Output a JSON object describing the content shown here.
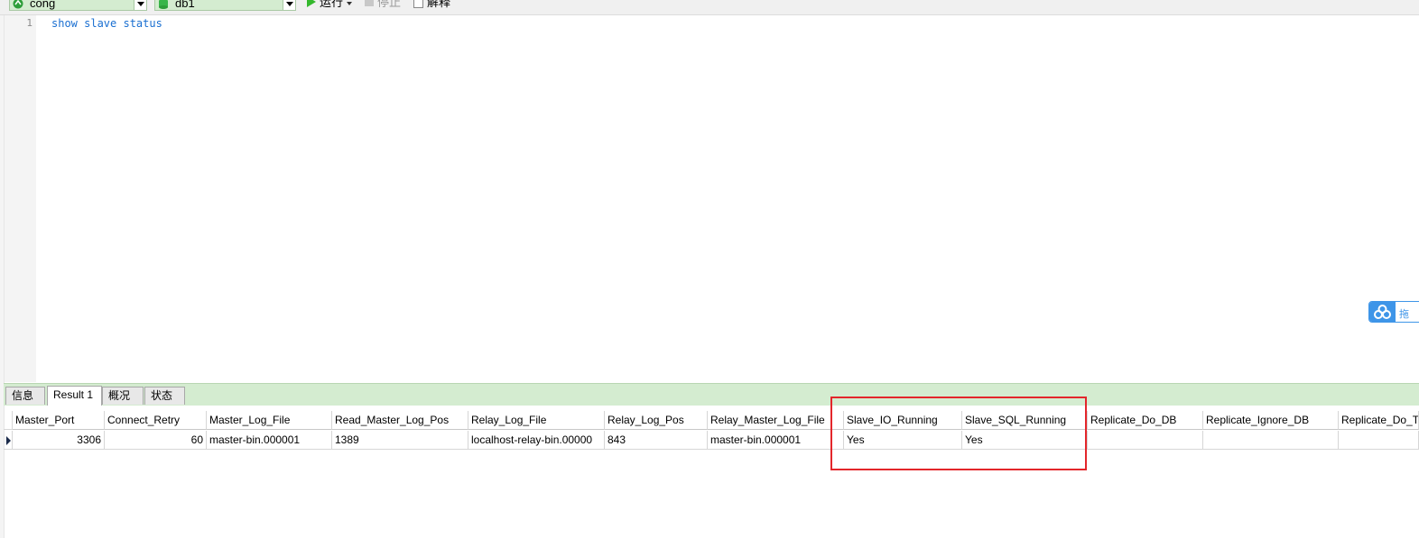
{
  "toolbar": {
    "connection": "cong",
    "database": "db1",
    "run_label": "运行",
    "stop_label": "停止",
    "explain_label": "解释"
  },
  "editor": {
    "line_number": "1",
    "code": "show slave status"
  },
  "side_widget": {
    "label": "拖"
  },
  "result_tabs": [
    "信息",
    "Result 1",
    "概况",
    "状态"
  ],
  "active_tab": "Result 1",
  "columns": [
    "Master_Port",
    "Connect_Retry",
    "Master_Log_File",
    "Read_Master_Log_Pos",
    "Relay_Log_File",
    "Relay_Log_Pos",
    "Relay_Master_Log_File",
    "Slave_IO_Running",
    "Slave_SQL_Running",
    "Replicate_Do_DB",
    "Replicate_Ignore_DB",
    "Replicate_Do_T"
  ],
  "rows": [
    [
      "3306",
      "60",
      "master-bin.000001",
      "1389",
      "localhost-relay-bin.00000",
      "843",
      "master-bin.000001",
      "Yes",
      "Yes",
      "",
      "",
      ""
    ]
  ],
  "colors": {
    "toolbar_combo_bg": "#d4ecd0",
    "tabbar_bg": "#d4ecd0",
    "code_keyword": "#1a6fd1",
    "highlight_box": "#e3262b",
    "widget_accent": "#3e95e8"
  }
}
